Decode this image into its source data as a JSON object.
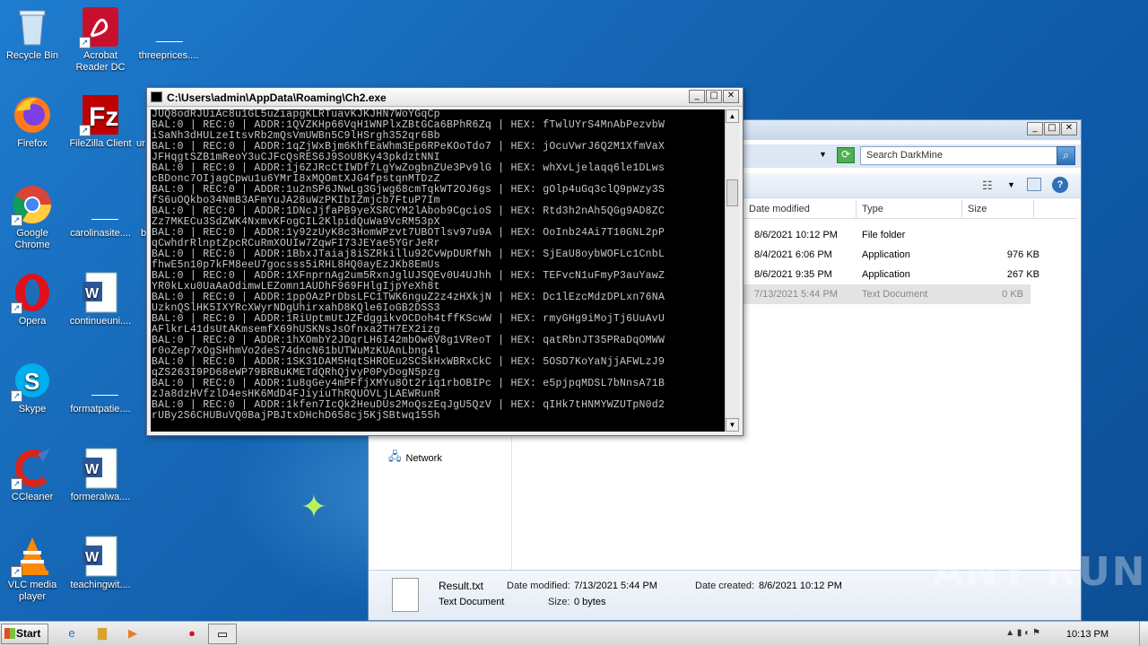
{
  "desktop": {
    "icons": [
      {
        "label": "Recycle Bin",
        "icon": "recycle-bin-icon"
      },
      {
        "label": "Acrobat Reader DC",
        "icon": "acrobat-icon"
      },
      {
        "label": "threeprices....",
        "icon": "blank-file-icon"
      },
      {
        "label": "Firefox",
        "icon": "firefox-icon"
      },
      {
        "label": "FileZilla Client",
        "icon": "filezilla-icon"
      },
      {
        "label": "ur",
        "icon": "blank-file-icon"
      },
      {
        "label": "Google Chrome",
        "icon": "chrome-icon"
      },
      {
        "label": "carolinasite....",
        "icon": "blank-file-icon"
      },
      {
        "label": "b",
        "icon": "blank-file-icon"
      },
      {
        "label": "Opera",
        "icon": "opera-icon"
      },
      {
        "label": "continueuni....",
        "icon": "word-doc-icon"
      },
      {
        "label": "Skype",
        "icon": "skype-icon"
      },
      {
        "label": "formatpatie....",
        "icon": "blank-file-icon"
      },
      {
        "label": "CCleaner",
        "icon": "ccleaner-icon"
      },
      {
        "label": "formeralwa....",
        "icon": "word-doc-icon"
      },
      {
        "label": "VLC media player",
        "icon": "vlc-icon"
      },
      {
        "label": "teachingwit....",
        "icon": "word-doc-icon"
      }
    ]
  },
  "console": {
    "title": "C:\\Users\\admin\\AppData\\Roaming\\Ch2.exe",
    "lines": [
      "JUQ8odRJUiAc8u1GL5uZiapgKLRTuavKJKJHN7WoYGqCp",
      "BAL:0 | REC:0 | ADDR:1QVZKHp66VqH1WNPlxZBtGCa6BPhR6Zq | HEX: fTwlUYrS4MnAbPezvbW",
      "iSaNh3dHULzeItsvRb2mQsVmUWBn5C9lHSrgh352qr6Bb",
      "BAL:0 | REC:0 | ADDR:1qZjWxBjm6KhfEaWhm3Ep6RPeKOoTdo7 | HEX: jOcuVwrJ6Q2M1XfmVaX",
      "JFHqgtSZB1mReoY3uCJFcQsRES6J9SoU8Ky43pkdztNNI",
      "BAL:0 | REC:0 | ADDR:1j6ZJRcCtIWDf7LgYwZogbnZUe3Pv9lG | HEX: whXvLjelaqq6le1DLws",
      "cBDonc7OIjagCpwu1u6YMrI8xMQOmtXJG4fpstqnMTDzZ",
      "BAL:0 | REC:0 | ADDR:1u2nSP6JNwLg3Gjwg68cmTqkWT2OJ6gs | HEX: gOlp4uGq3clQ9pWzy3S",
      "fS6uOQkbo34NmB3AFmYuJA28uWzPKIbIZmjcb7FtuP7Im",
      "BAL:0 | REC:0 | ADDR:1DNcJjfaPB9yeXSRCYM2lAbob9CgcioS | HEX: Rtd3h2nAh5QGg9AD8ZC",
      "Zz7MKECu3SdZWK4NxmvKFogCIL2KlpidQuWa9VcRM53pX",
      "BAL:0 | REC:0 | ADDR:1y92zUyK8c3HomWPzvt7UBOTlsv97u9A | HEX: OoInb24Ai7T10GNL2pP",
      "qCwhdrRlnptZpcRCuRmXOUIw7ZqwFI73JEYae5YGrJeRr",
      "BAL:0 | REC:0 | ADDR:1BbxJTaiaj8iSZRkillu92CvWpDURfNh | HEX: SjEaU8oybWOFLc1CnbL",
      "fhwE5n10p7kFM8eeU7gocsss5iRHL8HQ0ayEzJKb8EmUs",
      "BAL:0 | REC:0 | ADDR:1XFnprnAg2um5RxnJglUJSQEv0U4UJhh | HEX: TEFvcN1uFmyP3auYawZ",
      "YR0kLxu0UaAaOdimwLEZomn1AUDhF969FHlgIjpYeXh8t",
      "BAL:0 | REC:0 | ADDR:1ppOAzPrDbsLFC1TWK6nguZ2z4zHXkjN | HEX: Dc1lEzcMdzDPLxn76NA",
      "UzknQSlHK5IXYRcXWyrNDgUhirxahD8KQle6IoGB2DSS3",
      "BAL:0 | REC:0 | ADDR:1RiUptmUtJZFdggikvOCDoh4tffKScwW | HEX: rmyGHg9iMojTj6UuAvU",
      "AFlkrL41dsUtAKmsemfX69hUSKNsJsOfnxa2TH7EX2izg",
      "BAL:0 | REC:0 | ADDR:1hXOmbY2JDqrLH6I42mbOw6V8g1VReoT | HEX: qatRbnJT35PRaDqOMWW",
      "r0oZep7xOgSHhmVo2deS74dncN61bUTWuMzKUAnLbng4l",
      "BAL:0 | REC:0 | ADDR:1SK31DAM5HqtSHROEu2SCSkHxWBRxCkC | HEX: 5OSD7KoYaNjjAFWLzJ9",
      "qZS263I9PD68eWP79BRBuKMETdQRhQjvyP0PyDogN5pzg",
      "BAL:0 | REC:0 | ADDR:1u8qGey4mPFfjXMYu8Ot2riq1rbOBIPc | HEX: e5pjpqMDSL7bNnsA71B",
      "zJa8dzHVfzlD4esHK6MdD4FJiyiuThRQUOVLjLAEWRunR",
      "BAL:0 | REC:0 | ADDR:1kfen7IcQk2HeuDUs2MoQszEqJgU5QzV | HEX: qIHk7tHNMYWZUTpN0d2",
      "rUBy2S6CHUBuVQ0BajPBJtxDHchD658cj5KjSBtwq155h"
    ]
  },
  "explorer": {
    "search_placeholder": "Search DarkMine",
    "columns": [
      "Date modified",
      "Type",
      "Size"
    ],
    "rows": [
      {
        "date": "8/6/2021 10:12 PM",
        "type": "File folder",
        "size": ""
      },
      {
        "date": "8/4/2021 6:06 PM",
        "type": "Application",
        "size": "976 KB"
      },
      {
        "date": "8/6/2021 9:35 PM",
        "type": "Application",
        "size": "267 KB"
      },
      {
        "date": "7/13/2021 5:44 PM",
        "type": "Text Document",
        "size": "0 KB"
      }
    ],
    "nav_network": "Network",
    "details": {
      "name": "Result.txt",
      "type": "Text Document",
      "modified_label": "Date modified:",
      "modified": "7/13/2021 5:44 PM",
      "created_label": "Date created:",
      "created": "8/6/2021 10:12 PM",
      "size_label": "Size:",
      "size": "0 bytes"
    }
  },
  "taskbar": {
    "start_label": "Start",
    "clock": "10:13 PM"
  },
  "watermark": "ANY RUN"
}
